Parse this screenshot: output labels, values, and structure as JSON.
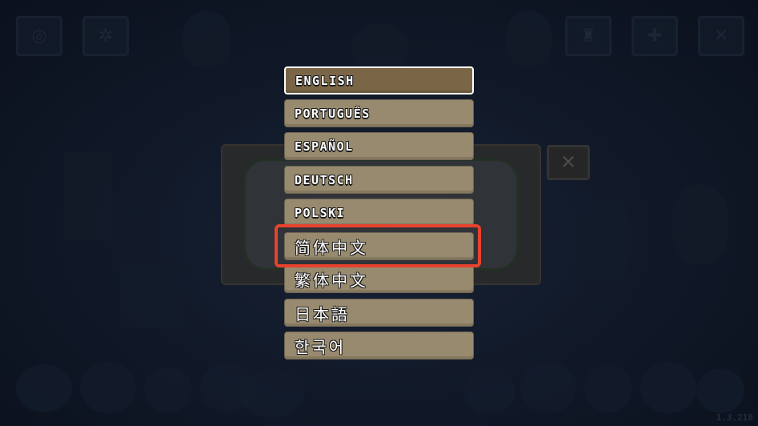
{
  "top_bar": {
    "left_icons": [
      "controller-icon",
      "gear-icon"
    ],
    "right_icons": [
      "trophy-icon",
      "dpad-icon",
      "close-icon"
    ]
  },
  "language_menu": {
    "items": [
      {
        "label": "English",
        "script": "latin",
        "selected": true
      },
      {
        "label": "Português",
        "script": "latin",
        "selected": false
      },
      {
        "label": "Español",
        "script": "latin",
        "selected": false
      },
      {
        "label": "Deutsch",
        "script": "latin",
        "selected": false
      },
      {
        "label": "Polski",
        "script": "latin",
        "selected": false
      },
      {
        "label": "简体中文",
        "script": "cjk",
        "selected": false
      },
      {
        "label": "繁体中文",
        "script": "cjk",
        "selected": false
      },
      {
        "label": "日本語",
        "script": "cjk",
        "selected": false
      },
      {
        "label": "한국어",
        "script": "cjk",
        "selected": false
      }
    ],
    "highlighted_item": "简体中文"
  },
  "panel": {
    "close_icon": "close-icon"
  },
  "colors": {
    "background": "#101827",
    "button_fill": "#978a6e",
    "selected_fill": "#7a6647",
    "highlight_border": "#e8422c",
    "text": "#ffffff"
  },
  "version": "1.3.218"
}
